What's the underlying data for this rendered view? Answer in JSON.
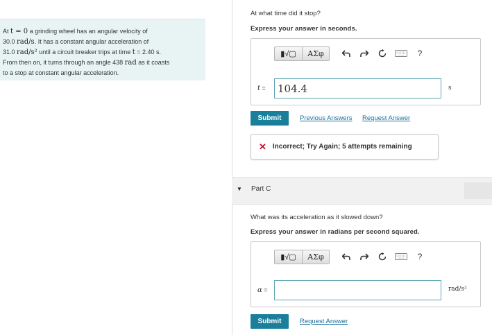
{
  "problem": {
    "line1_pre": "At ",
    "line1_math": "t = 0",
    "line1_post": " a grinding wheel has an angular velocity of",
    "line2_pre": "30.0 ",
    "line2_math": "rad/s",
    "line2_post": ". It has a constant angular acceleration of",
    "line3_pre": "31.0 ",
    "line3_math": "rad/s²",
    "line3_mid": " until a circuit breaker trips at time ",
    "line3_math2": "t",
    "line3_post": " = 2.40 s.",
    "line4_pre": "From then on, it turns through an angle 438 ",
    "line4_math": "rad",
    "line4_post": " as it coasts",
    "line5": "to a stop at constant angular acceleration."
  },
  "partB": {
    "question": "At what time did it stop?",
    "instruction": "Express your answer in seconds.",
    "variable": "t",
    "equals": " =",
    "answer_value": "104.4",
    "unit": "s",
    "submit_label": "Submit",
    "previous_answers_label": "Previous Answers",
    "request_answer_label": "Request Answer",
    "feedback_icon": "✕",
    "feedback_text": "Incorrect; Try Again; 5 attempts remaining"
  },
  "toolbar": {
    "template_label": "▮√▢",
    "greek_label": "ΑΣφ",
    "help_label": "?",
    "icons": [
      "undo-icon",
      "redo-icon",
      "reset-icon",
      "keyboard-icon",
      "help-icon"
    ]
  },
  "partC": {
    "header_title": "Part C",
    "question": "What was its acceleration as it slowed down?",
    "instruction": "Express your answer in radians per second squared.",
    "variable": "α",
    "equals": " =",
    "answer_value": "",
    "unit": "rad/s²",
    "submit_label": "Submit",
    "request_answer_label": "Request Answer"
  },
  "colors": {
    "accent": "#1a7f9b",
    "link": "#1a6f9b",
    "error": "#c8102e",
    "problem_bg": "#e8f4f4",
    "input_border": "#5aa6b0"
  }
}
